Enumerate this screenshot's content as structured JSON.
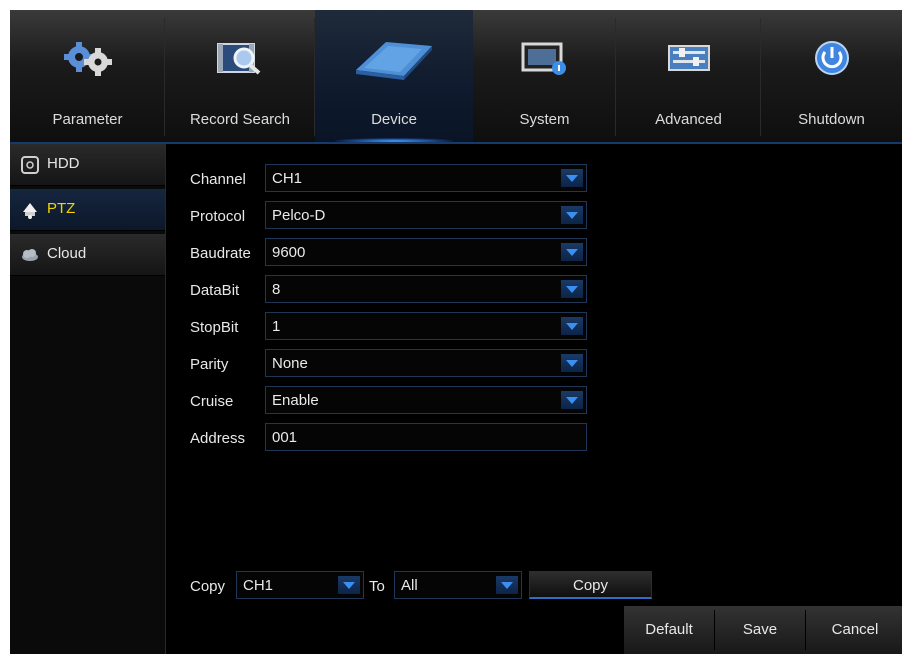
{
  "nav": {
    "tabs": [
      {
        "label": "Parameter",
        "icon": "gears-icon"
      },
      {
        "label": "Record Search",
        "icon": "record-search-icon"
      },
      {
        "label": "Device",
        "icon": "hard-drive-icon",
        "active": true
      },
      {
        "label": "System",
        "icon": "system-monitor-icon"
      },
      {
        "label": "Advanced",
        "icon": "advanced-sliders-icon"
      },
      {
        "label": "Shutdown",
        "icon": "power-icon"
      }
    ]
  },
  "sidebar": {
    "items": [
      {
        "label": "HDD",
        "icon": "hdd-icon"
      },
      {
        "label": "PTZ",
        "icon": "ptz-camera-icon",
        "active": true
      },
      {
        "label": "Cloud",
        "icon": "cloud-icon"
      }
    ]
  },
  "form": {
    "channel": {
      "label": "Channel",
      "value": "CH1"
    },
    "protocol": {
      "label": "Protocol",
      "value": "Pelco-D"
    },
    "baudrate": {
      "label": "Baudrate",
      "value": "9600"
    },
    "databit": {
      "label": "DataBit",
      "value": "8"
    },
    "stopbit": {
      "label": "StopBit",
      "value": "1"
    },
    "parity": {
      "label": "Parity",
      "value": "None"
    },
    "cruise": {
      "label": "Cruise",
      "value": "Enable"
    },
    "address": {
      "label": "Address",
      "value": "001"
    }
  },
  "copy": {
    "label": "Copy",
    "from_value": "CH1",
    "to_label": "To",
    "to_value": "All",
    "button": "Copy"
  },
  "footer": {
    "default": "Default",
    "save": "Save",
    "cancel": "Cancel"
  },
  "colors": {
    "accent": "#2d6fc8",
    "active_sidebar_text": "#f1d300"
  }
}
